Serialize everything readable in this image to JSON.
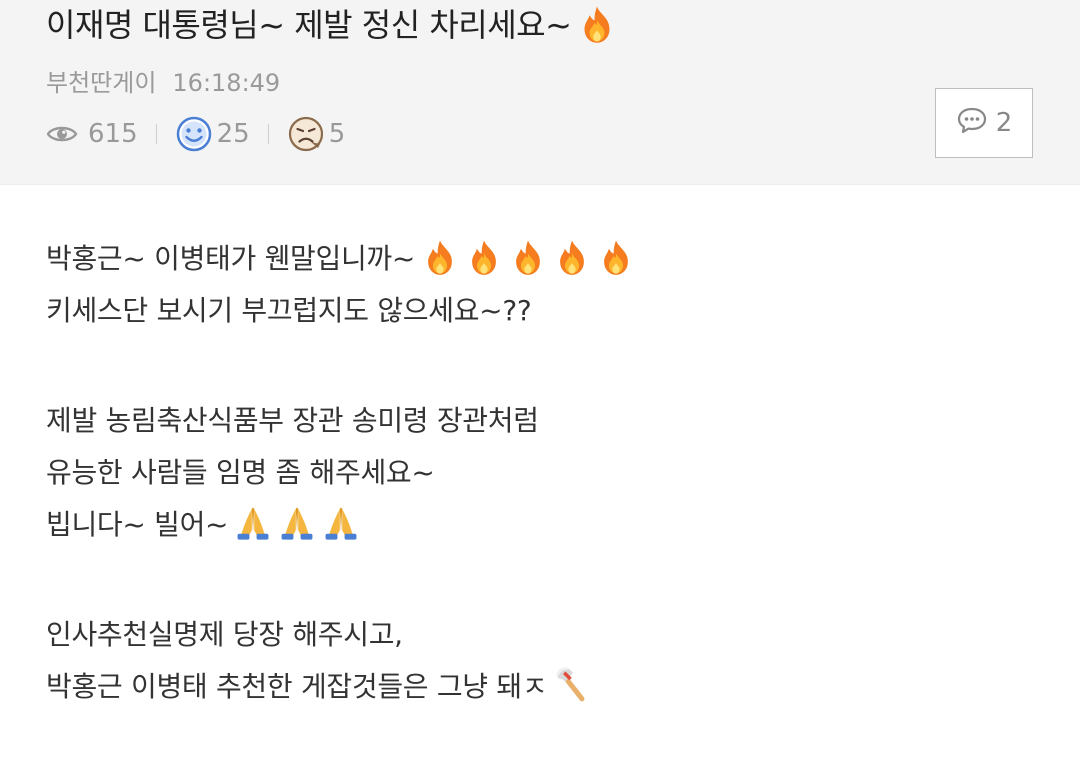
{
  "post": {
    "title": "이재명 대통령님~ 제발 정신 차리세요~",
    "author": "부천딴게이",
    "time": "16:18:49",
    "views": "615",
    "likes": "25",
    "dislikes": "5",
    "comment_count": "2"
  },
  "content": {
    "line1": "박홍근~ 이병태가 웬말입니까~",
    "line2": "키세스단 보시기 부끄럽지도 않으세요~??",
    "line3": "제발 농림축산식품부 장관 송미령 장관처럼",
    "line4": "유능한 사람들 임명 좀 해주세요~",
    "line5": "빕니다~ 빌어~",
    "line6": "인사추천실명제 당장 해주시고,",
    "line7": "박홍근 이병태 추천한 게잡것들은 그냥 돼ㅈ"
  },
  "icons": {
    "views": "eye-icon",
    "likes": "smiley-icon",
    "dislikes": "frown-icon",
    "comments": "speech-bubble-icon",
    "fire": "fire-emoji",
    "pray": "folded-hands-emoji",
    "axe": "axe-emoji"
  },
  "colors": {
    "header_bg": "#f4f4f4",
    "meta_text": "#9a9a9a",
    "smiley_blue": "#4a7fd4",
    "fire_orange": "#f57c1f"
  }
}
